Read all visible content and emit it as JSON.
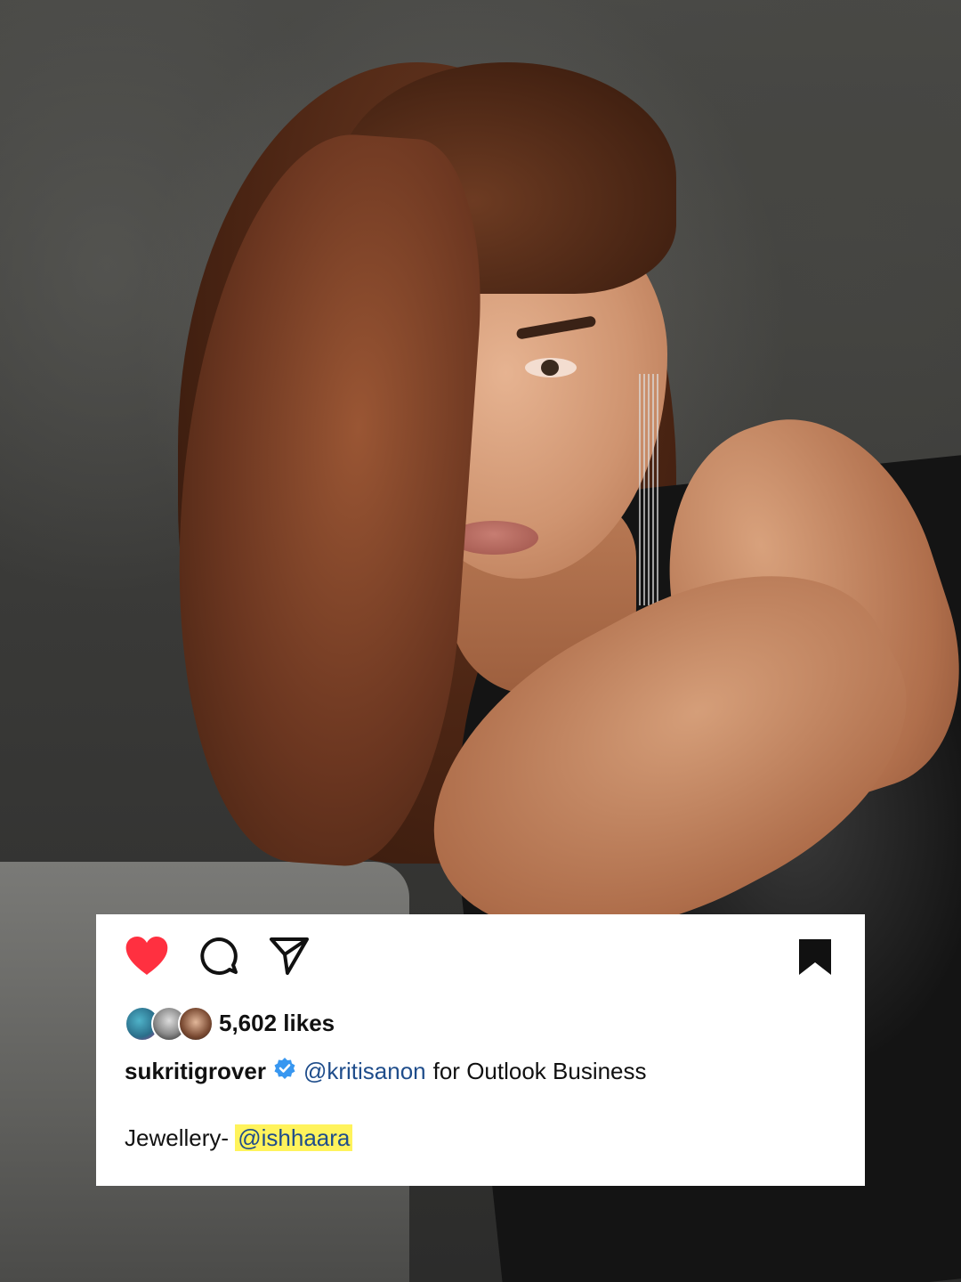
{
  "post": {
    "likes_text": "5,602 likes",
    "username": "sukritigrover",
    "verified": true,
    "caption_mention": "@kritisanon",
    "caption_rest": "for Outlook Business",
    "jewellery_label": "Jewellery- ",
    "jewellery_mention": "@ishhaara"
  },
  "icons": {
    "like": "heart-icon",
    "comment": "comment-icon",
    "share": "send-icon",
    "save": "bookmark-icon",
    "verified": "verified-badge-icon"
  },
  "colors": {
    "heart": "#ff3040",
    "verified": "#3897f0",
    "mention": "#1f4d8b",
    "highlight": "#fff35c",
    "card_background": "#ffffff"
  }
}
